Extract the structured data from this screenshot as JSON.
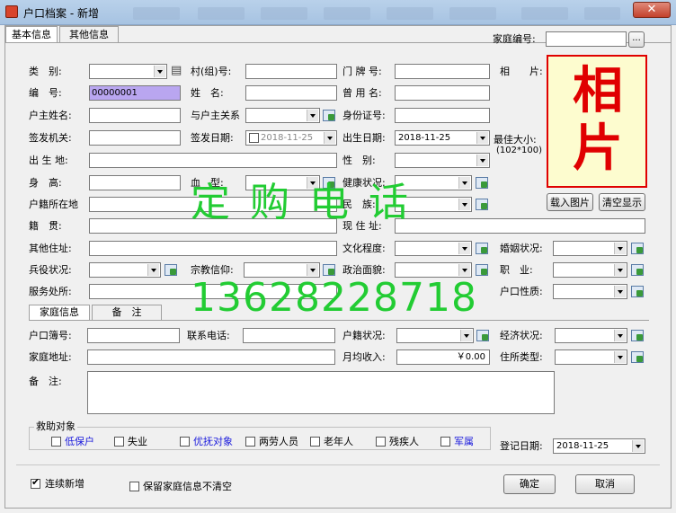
{
  "window": {
    "title": "户口档案 - 新增",
    "close": "✕"
  },
  "tabs": [
    "基本信息",
    "其他信息"
  ],
  "family_no": {
    "label": "家庭编号:",
    "btn": "..."
  },
  "labels": {
    "category": "类　别:",
    "village": "村(组)号:",
    "house_no": "门 牌 号:",
    "photo": "相　　片:",
    "code": "编　号:",
    "name": "姓　名:",
    "former_name": "曾 用 名:",
    "head_name": "户主姓名:",
    "relation": "与户主关系",
    "id_no": "身份证号:",
    "issuer": "签发机关:",
    "issue_date": "签发日期:",
    "birth_date": "出生日期:",
    "birthplace": "出 生 地:",
    "sex": "性　别:",
    "height": "身　高:",
    "blood": "血　型:",
    "health": "健康状况:",
    "reg_place": "户籍所在地",
    "ethnic": "民　族:",
    "native": "籍　贯:",
    "current_addr": "现 住 址:",
    "other_addr": "其他住址:",
    "education": "文化程度:",
    "marriage": "婚姻状况:",
    "military": "兵役状况:",
    "religion": "宗教信仰:",
    "politics": "政治面貌:",
    "job": "职　业:",
    "workplace": "服务处所:",
    "hukou_type": "户口性质:"
  },
  "values": {
    "code": "00000001",
    "issue_date": "2018-11-25",
    "birth_date": "2018-11-25"
  },
  "photo_panel": {
    "text": "相片",
    "best_size": "最佳大小:",
    "size": "(102*100)",
    "load_btn": "载入图片",
    "clear_btn": "清空显示"
  },
  "watermark": {
    "line1": "定 购 电 话",
    "line2": "13628228718"
  },
  "subtabs": [
    "家庭信息",
    "备　注"
  ],
  "family": {
    "book_no": "户口簿号:",
    "phone": "联系电话:",
    "reg_status": "户籍状况:",
    "econ": "经济状况:",
    "addr": "家庭地址:",
    "income": "月均收入:",
    "income_val": "￥0.00",
    "housing": "住所类型:",
    "remark": "备　注:"
  },
  "aid": {
    "title": "救助对象",
    "items": [
      "低保户",
      "失业",
      "优抚对象",
      "两劳人员",
      "老年人",
      "残疾人",
      "军属"
    ]
  },
  "reg_date": {
    "label": "登记日期:",
    "value": "2018-11-25"
  },
  "bottom": {
    "continue": "连续新增",
    "keep": "保留家庭信息不清空",
    "ok": "确定",
    "cancel": "取消"
  },
  "colors": {
    "photo_bg": "#fdfccf",
    "photo_text": "#e00000",
    "watermark": "#22cc33",
    "code_bg": "#b9a6f0",
    "blue_text": "#1a1adc"
  }
}
